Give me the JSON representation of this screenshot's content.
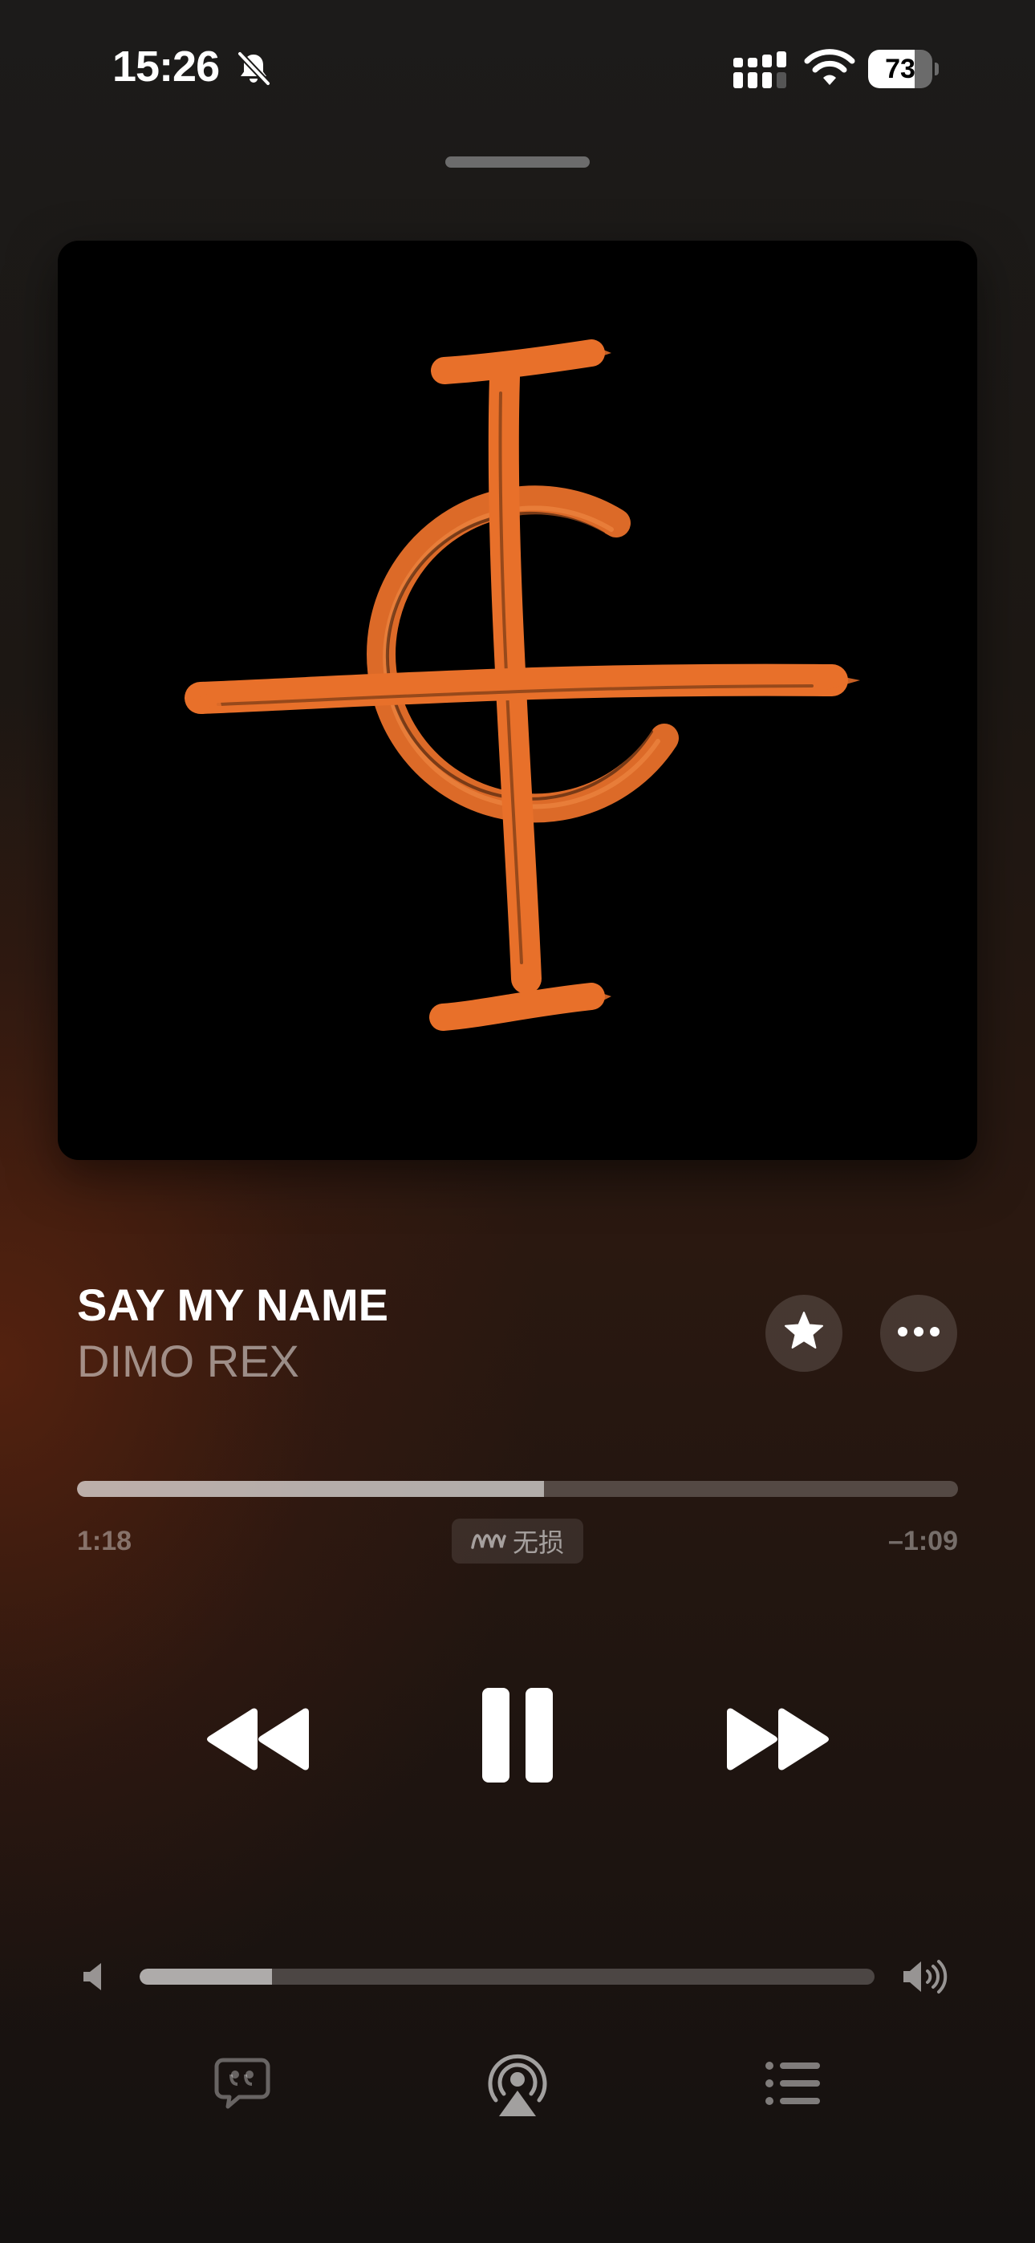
{
  "status_bar": {
    "time": "15:26",
    "battery_level": "73",
    "battery_fraction": 0.73,
    "icons": [
      "bell-slash-icon",
      "cellular-signal-icon",
      "wifi-icon",
      "battery-icon"
    ]
  },
  "artwork": {
    "description_icon": "album-artwork",
    "accent_color": "#E8702A"
  },
  "track": {
    "title": "SAY MY NAME",
    "artist": "DIMO REX"
  },
  "actions": {
    "favorite_icon": "star-icon",
    "more_icon": "ellipsis-icon"
  },
  "playback": {
    "elapsed": "1:18",
    "remaining": "–1:09",
    "progress_fraction": 0.53,
    "quality_label": "无损",
    "quality_icon": "lossless-wave-icon"
  },
  "controls": {
    "rewind_icon": "rewind-icon",
    "pause_icon": "pause-icon",
    "forward_icon": "fast-forward-icon"
  },
  "volume": {
    "level_fraction": 0.18,
    "low_icon": "speaker-low-icon",
    "high_icon": "speaker-high-icon"
  },
  "bottom_bar": {
    "lyrics_icon": "lyrics-quote-bubble-icon",
    "airplay_icon": "airplay-audio-icon",
    "queue_icon": "queue-list-icon"
  },
  "colors": {
    "accent": "#E8702A",
    "background_top": "#1c1b1a",
    "background_glow": "#782a0e"
  }
}
